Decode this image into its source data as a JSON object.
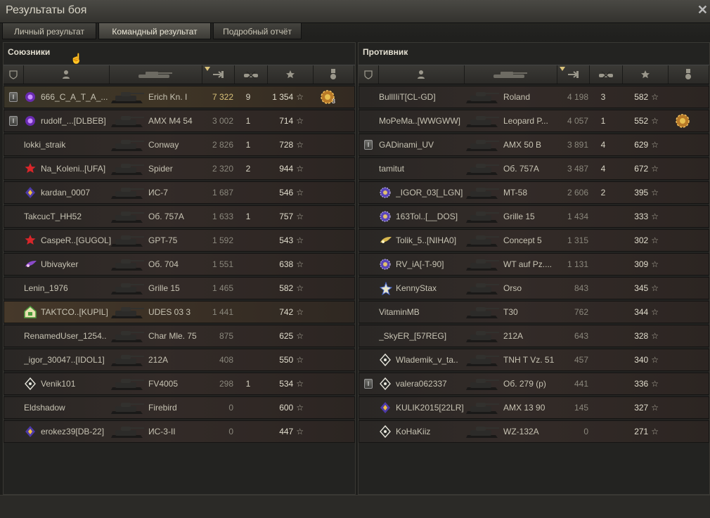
{
  "window": {
    "title": "Результаты боя",
    "close_icon": "✕"
  },
  "tabs": [
    {
      "label": "Личный результат",
      "active": false
    },
    {
      "label": "Командный результат",
      "active": true
    },
    {
      "label": "Подробный отчёт",
      "active": false
    }
  ],
  "allies": {
    "title": "Союзники",
    "rows": [
      {
        "player": "666_C_A_T_A_...",
        "tank": "Erich Kn. I",
        "damage": "7 322",
        "kills": "9",
        "xp": "1 354",
        "badge": true,
        "clan_icon": "purple-orb-icon",
        "medal": "orders-medal-icon",
        "medal_count": "3",
        "row_style": "hl",
        "damage_top": true
      },
      {
        "player": "rudolf_...[DLBEB]",
        "tank": "AMX M4 54",
        "damage": "3 002",
        "kills": "1",
        "xp": "714",
        "badge": true,
        "clan_icon": "purple-orb-icon",
        "medal": "",
        "medal_count": "",
        "row_style": "",
        "damage_top": false
      },
      {
        "player": "lokki_straik",
        "tank": "Conway",
        "damage": "2 826",
        "kills": "1",
        "xp": "728",
        "badge": false,
        "clan_icon": "",
        "medal": "",
        "medal_count": "",
        "row_style": "",
        "damage_top": false
      },
      {
        "player": "Na_Koleni..[UFA]",
        "tank": "Spider",
        "damage": "2 320",
        "kills": "2",
        "xp": "944",
        "badge": false,
        "clan_icon": "red-star-icon",
        "medal": "",
        "medal_count": "",
        "row_style": "",
        "damage_top": false
      },
      {
        "player": "kardan_0007",
        "tank": "ИС-7",
        "damage": "1 687",
        "kills": "",
        "xp": "546",
        "badge": false,
        "clan_icon": "purple-rhombus-icon",
        "medal": "",
        "medal_count": "",
        "row_style": "",
        "damage_top": false
      },
      {
        "player": "TakcucT_HH52",
        "tank": "Об. 757A",
        "damage": "1 633",
        "kills": "1",
        "xp": "757",
        "badge": false,
        "clan_icon": "",
        "medal": "",
        "medal_count": "",
        "row_style": "",
        "damage_top": false
      },
      {
        "player": "CaspeR..[GUGOL]",
        "tank": "GPT-75",
        "damage": "1 592",
        "kills": "",
        "xp": "543",
        "badge": false,
        "clan_icon": "red-star-icon",
        "medal": "",
        "medal_count": "",
        "row_style": "",
        "damage_top": false
      },
      {
        "player": "Ubivayker",
        "tank": "Об. 704",
        "damage": "1 551",
        "kills": "",
        "xp": "638",
        "badge": false,
        "clan_icon": "purple-wing-icon",
        "medal": "",
        "medal_count": "",
        "row_style": "",
        "damage_top": false
      },
      {
        "player": "Lenin_1976",
        "tank": "Grille 15",
        "damage": "1 465",
        "kills": "",
        "xp": "582",
        "badge": false,
        "clan_icon": "",
        "medal": "",
        "medal_count": "",
        "row_style": "",
        "damage_top": false
      },
      {
        "player": "TAKTCO..[KUPIL]",
        "tank": "UDES 03 3",
        "damage": "1 441",
        "kills": "",
        "xp": "742",
        "badge": false,
        "clan_icon": "green-house-icon",
        "medal": "",
        "medal_count": "",
        "row_style": "gold",
        "damage_top": false
      },
      {
        "player": "RenamedUser_1254..",
        "tank": "Char Mle. 75",
        "damage": "875",
        "kills": "",
        "xp": "625",
        "badge": false,
        "clan_icon": "",
        "medal": "",
        "medal_count": "",
        "row_style": "",
        "damage_top": false
      },
      {
        "player": "_igor_30047..[IDOL1]",
        "tank": "212A",
        "damage": "408",
        "kills": "",
        "xp": "550",
        "badge": false,
        "clan_icon": "",
        "medal": "",
        "medal_count": "",
        "row_style": "",
        "damage_top": false
      },
      {
        "player": "Venik101",
        "tank": "FV4005",
        "damage": "298",
        "kills": "1",
        "xp": "534",
        "badge": false,
        "clan_icon": "white-diamond-icon",
        "medal": "",
        "medal_count": "",
        "row_style": "",
        "damage_top": false
      },
      {
        "player": "Eldshadow",
        "tank": "Firebird",
        "damage": "0",
        "kills": "",
        "xp": "600",
        "badge": false,
        "clan_icon": "",
        "medal": "",
        "medal_count": "",
        "row_style": "",
        "damage_top": false
      },
      {
        "player": "erokez39[DB-22]",
        "tank": "ИС-3-II",
        "damage": "0",
        "kills": "",
        "xp": "447",
        "badge": false,
        "clan_icon": "purple-rhombus-icon",
        "medal": "",
        "medal_count": "",
        "row_style": "",
        "damage_top": false
      }
    ]
  },
  "enemies": {
    "title": "Противник",
    "rows": [
      {
        "player": "BullIIiT[CL-GD]",
        "tank": "Roland",
        "damage": "4 198",
        "kills": "3",
        "xp": "582",
        "badge": false,
        "clan_icon": "",
        "medal": "",
        "row_style": ""
      },
      {
        "player": "MoPeMa..[WWGWW]",
        "tank": "Leopard P...",
        "damage": "4 057",
        "kills": "1",
        "xp": "552",
        "badge": false,
        "clan_icon": "",
        "medal": "orders-medal-icon",
        "row_style": ""
      },
      {
        "player": "GADinami_UV",
        "tank": "AMX 50 B",
        "damage": "3 891",
        "kills": "4",
        "xp": "629",
        "badge": true,
        "clan_icon": "",
        "medal": "",
        "row_style": ""
      },
      {
        "player": "tamitut",
        "tank": "Об. 757A",
        "damage": "3 487",
        "kills": "4",
        "xp": "672",
        "badge": false,
        "clan_icon": "",
        "medal": "",
        "row_style": ""
      },
      {
        "player": "_IGOR_03[_LGN]",
        "tank": "MT-58",
        "damage": "2 606",
        "kills": "2",
        "xp": "395",
        "badge": false,
        "clan_icon": "purple-gear-icon",
        "medal": "",
        "row_style": ""
      },
      {
        "player": "163Tol..[__DOS]",
        "tank": "Grille 15",
        "damage": "1 434",
        "kills": "",
        "xp": "333",
        "badge": false,
        "clan_icon": "purple-gear-icon",
        "medal": "",
        "row_style": ""
      },
      {
        "player": "Tolik_5..[NIHA0]",
        "tank": "Concept 5",
        "damage": "1 315",
        "kills": "",
        "xp": "302",
        "badge": false,
        "clan_icon": "gold-wing-icon",
        "medal": "",
        "row_style": ""
      },
      {
        "player": "RV_iA[-T-90]",
        "tank": "WT auf Pz....",
        "damage": "1 131",
        "kills": "",
        "xp": "309",
        "badge": false,
        "clan_icon": "purple-gear-icon",
        "medal": "",
        "row_style": ""
      },
      {
        "player": "KennyStax",
        "tank": "Orso",
        "damage": "843",
        "kills": "",
        "xp": "345",
        "badge": false,
        "clan_icon": "blue-star-icon",
        "medal": "",
        "row_style": ""
      },
      {
        "player": "VitaminMB",
        "tank": "T30",
        "damage": "762",
        "kills": "",
        "xp": "344",
        "badge": false,
        "clan_icon": "",
        "medal": "",
        "row_style": ""
      },
      {
        "player": "_SkyER_[57REG]",
        "tank": "212A",
        "damage": "643",
        "kills": "",
        "xp": "328",
        "badge": false,
        "clan_icon": "",
        "medal": "",
        "row_style": ""
      },
      {
        "player": "Wlademik_v_ta..",
        "tank": "TNH T Vz. 51",
        "damage": "457",
        "kills": "",
        "xp": "340",
        "badge": false,
        "clan_icon": "white-diamond-icon",
        "medal": "",
        "row_style": ""
      },
      {
        "player": "valera062337",
        "tank": "Об. 279 (р)",
        "damage": "441",
        "kills": "",
        "xp": "336",
        "badge": true,
        "clan_icon": "white-diamond-icon",
        "medal": "",
        "row_style": ""
      },
      {
        "player": "KULIK2015[22LR]",
        "tank": "AMX 13 90",
        "damage": "145",
        "kills": "",
        "xp": "327",
        "badge": false,
        "clan_icon": "purple-rhombus-icon",
        "medal": "",
        "row_style": ""
      },
      {
        "player": "KoHaKiiz",
        "tank": "WZ-132A",
        "damage": "0",
        "kills": "",
        "xp": "271",
        "badge": false,
        "clan_icon": "white-diamond-icon",
        "medal": "",
        "row_style": ""
      }
    ]
  },
  "colors": {
    "accent": "#d9c27a",
    "text": "#c7c3b3",
    "panel": "#232321"
  }
}
